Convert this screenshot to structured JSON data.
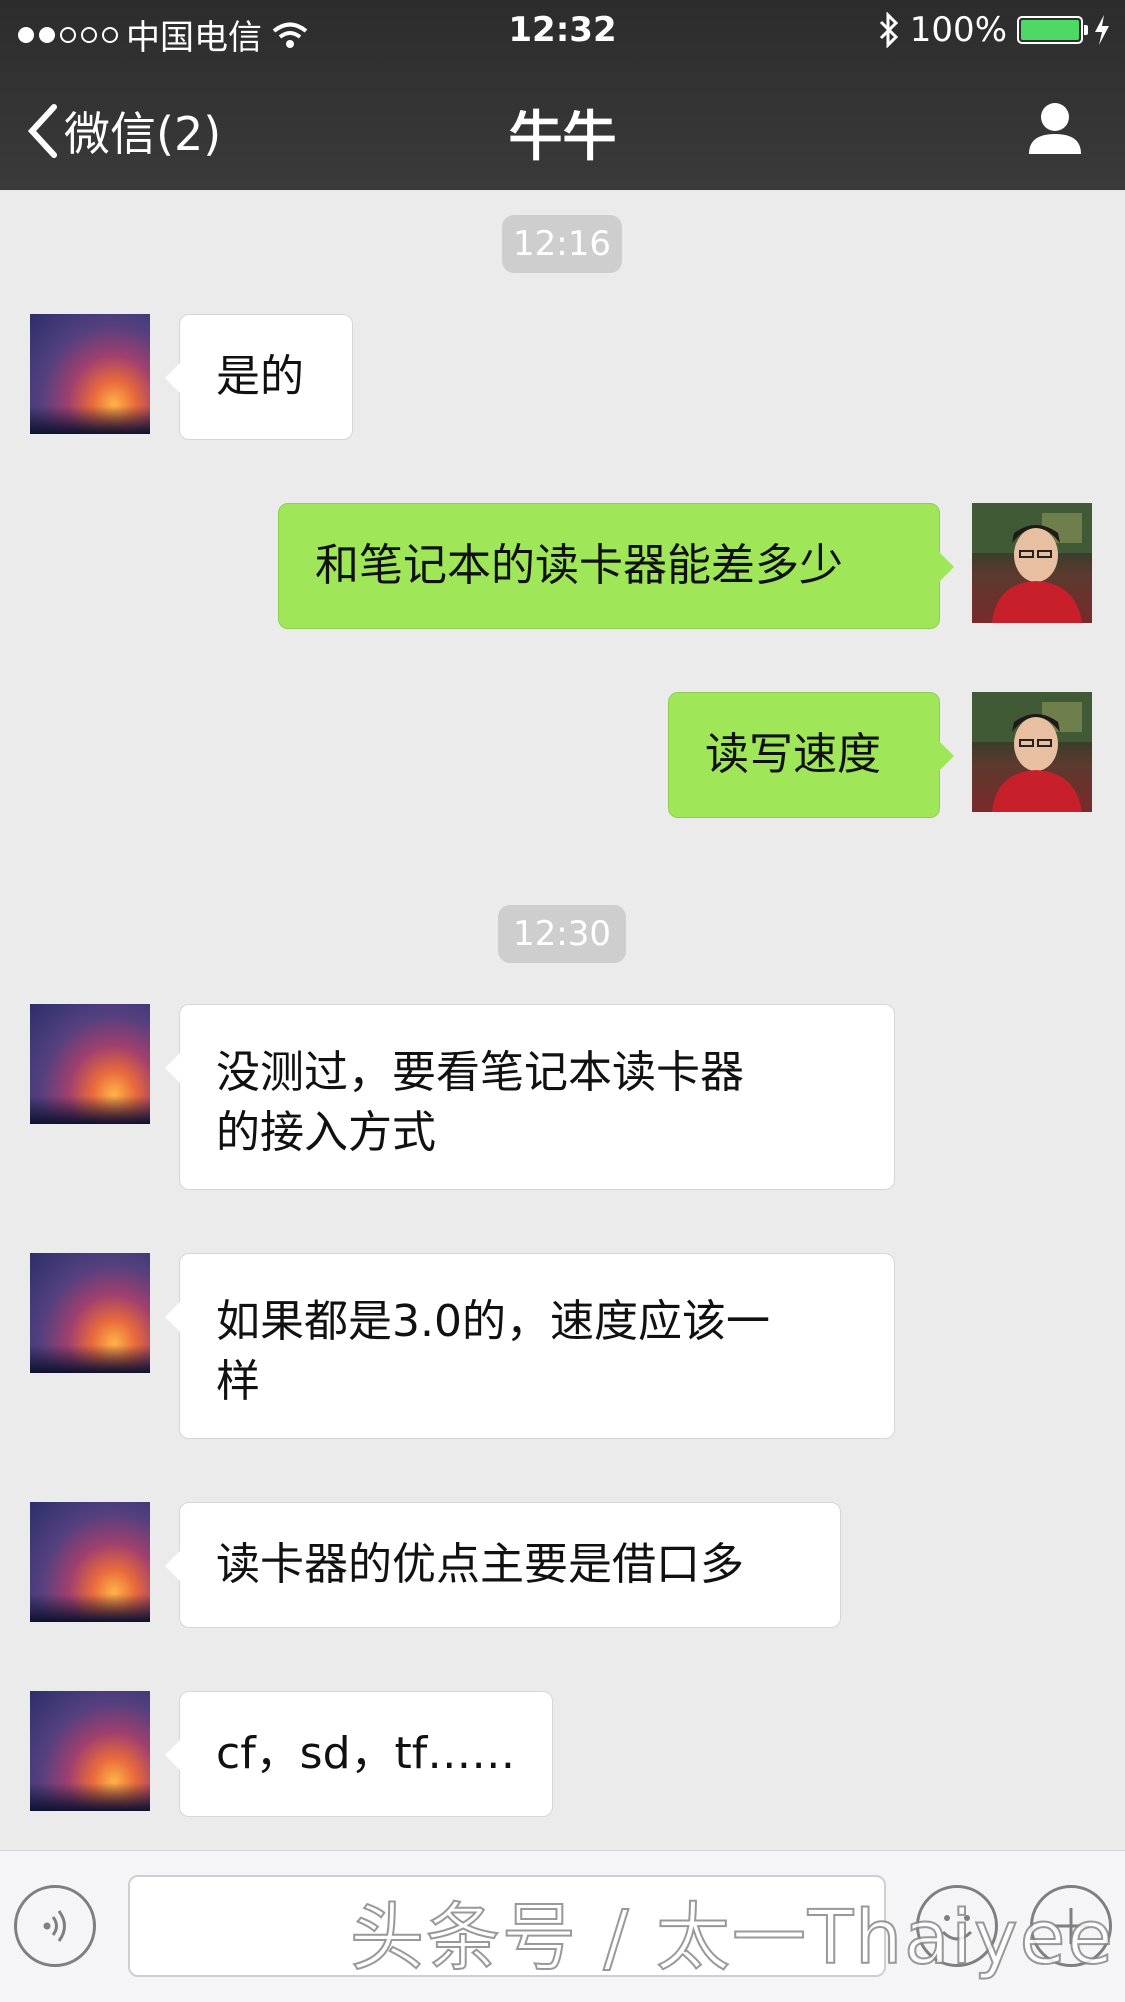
{
  "status_bar": {
    "carrier": "中国电信",
    "time": "12:32",
    "battery": "100%"
  },
  "nav": {
    "back_label": "微信(2)",
    "title": "牛牛"
  },
  "messages": {
    "time_1": "12:16",
    "m1": "是的",
    "m2": "和笔记本的读卡器能差多少",
    "m3": "读写速度",
    "time_2": "12:30",
    "m4_line1": "没测过，要看笔记本读卡器",
    "m4_line2": "的接入方式",
    "m5_line1": "如果都是3.0的，速度应该一",
    "m5_line2": "样",
    "m6": "读卡器的优点主要是借口多",
    "m7": "cf，sd，tf……"
  },
  "watermark": "头条号 / 太一Thaiyee",
  "colors": {
    "outgoing_bubble": "#9fe658",
    "incoming_bubble": "#ffffff",
    "background": "#ebebeb",
    "nav_bar": "#333333"
  }
}
